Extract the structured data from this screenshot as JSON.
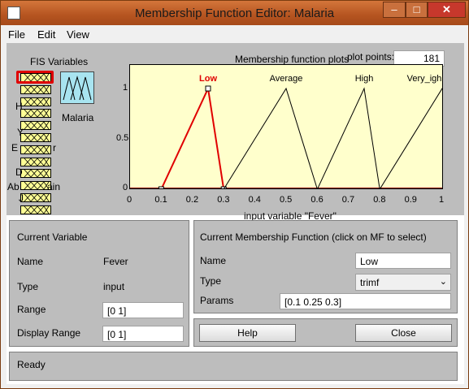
{
  "window": {
    "title": "Membership Function Editor: Malaria",
    "min_glyph": "–",
    "max_glyph": "□",
    "close_glyph": "✕"
  },
  "menu": {
    "items": [
      "File",
      "Edit",
      "View"
    ]
  },
  "fis": {
    "label": "FIS Variables",
    "system_name": "Malaria"
  },
  "fis_partial_labels": [
    "H",
    "Y",
    "E",
    "r",
    "D",
    "Ab",
    "ain",
    "J"
  ],
  "plot": {
    "heading": "Membership function plots",
    "points_label": "plot points:",
    "points_value": "181",
    "xlabel": "input variable \"Fever\"",
    "yticks": [
      "1",
      "0.5",
      "0"
    ],
    "xticks": [
      "0",
      "0.1",
      "0.2",
      "0.3",
      "0.4",
      "0.5",
      "0.6",
      "0.7",
      "0.8",
      "0.9",
      "1"
    ],
    "mf_labels": [
      "Low",
      "Average",
      "High",
      "Very_igh"
    ],
    "colors": {
      "selected": "#e00000",
      "normal": "#000000",
      "baseline": "#8b0000"
    }
  },
  "current_variable": {
    "header": "Current Variable",
    "name_label": "Name",
    "name_value": "Fever",
    "type_label": "Type",
    "type_value": "input",
    "range_label": "Range",
    "range_value": "[0 1]",
    "display_range_label": "Display Range",
    "display_range_value": "[0 1]"
  },
  "current_mf": {
    "header": "Current Membership Function (click on MF to select)",
    "name_label": "Name",
    "name_value": "Low",
    "type_label": "Type",
    "type_value": "trimf",
    "params_label": "Params",
    "params_value": "[0.1 0.25 0.3]"
  },
  "buttons": {
    "help": "Help",
    "close": "Close"
  },
  "status": "Ready",
  "chart_data": {
    "type": "line",
    "xlabel": "input variable \"Fever\"",
    "xlim": [
      0,
      1
    ],
    "ylim": [
      0,
      1
    ],
    "series": [
      {
        "name": "Low",
        "x": [
          0.1,
          0.25,
          0.3
        ],
        "y": [
          0,
          1,
          0
        ],
        "selected": true
      },
      {
        "name": "Average",
        "x": [
          0.3,
          0.5,
          0.6
        ],
        "y": [
          0,
          1,
          0
        ]
      },
      {
        "name": "High",
        "x": [
          0.6,
          0.75,
          0.8
        ],
        "y": [
          0,
          1,
          0
        ]
      },
      {
        "name": "Very_igh",
        "x": [
          0.8,
          1.0,
          1.2
        ],
        "y": [
          0,
          1,
          0
        ]
      }
    ]
  }
}
